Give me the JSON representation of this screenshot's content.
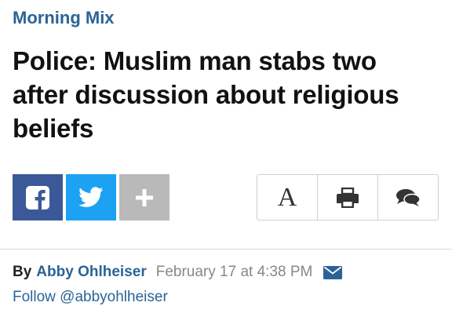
{
  "section": {
    "kicker": "Morning Mix"
  },
  "article": {
    "headline": "Police: Muslim man stabs two after discussion about religious beliefs"
  },
  "share": {
    "buttons": [
      {
        "name": "facebook",
        "icon": "facebook-icon",
        "color": "#3b5998"
      },
      {
        "name": "twitter",
        "icon": "twitter-icon",
        "color": "#1da1f2"
      },
      {
        "name": "more",
        "icon": "plus-icon",
        "color": "#b9b9b9"
      }
    ]
  },
  "tools": {
    "font_size_label": "A",
    "items": [
      {
        "name": "font-size",
        "icon": "font-size-icon"
      },
      {
        "name": "print",
        "icon": "printer-icon"
      },
      {
        "name": "comments",
        "icon": "comments-icon"
      }
    ]
  },
  "byline": {
    "by": "By",
    "author": "Abby Ohlheiser",
    "date": "February 17 at 4:38 PM",
    "mail_icon": "envelope-icon",
    "follow": "Follow @abbyohlheiser"
  },
  "colors": {
    "link": "#2a6496"
  }
}
